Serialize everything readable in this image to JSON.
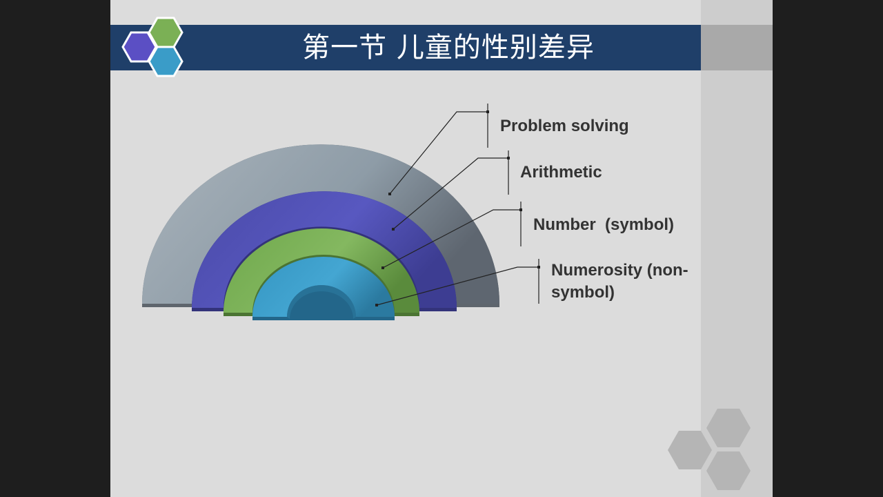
{
  "slide": {
    "title": "第一节  儿童的性别差异"
  },
  "diagram": {
    "layers": [
      {
        "label": "Problem solving",
        "color": "#8e9ca7"
      },
      {
        "label": "Arithmetic",
        "color": "#5555bb"
      },
      {
        "label": "Number  (symbol)",
        "color": "#7bb055"
      },
      {
        "label": "Numerosity (non-symbol)",
        "label_line1": "Numerosity (non-",
        "label_line2": "symbol)",
        "color": "#3a9cc8"
      }
    ]
  },
  "decor": {
    "hex_colors": [
      "#5b4fc4",
      "#7bb055",
      "#3a9cc8"
    ],
    "corner_hex_color": "#b5b5b5"
  }
}
